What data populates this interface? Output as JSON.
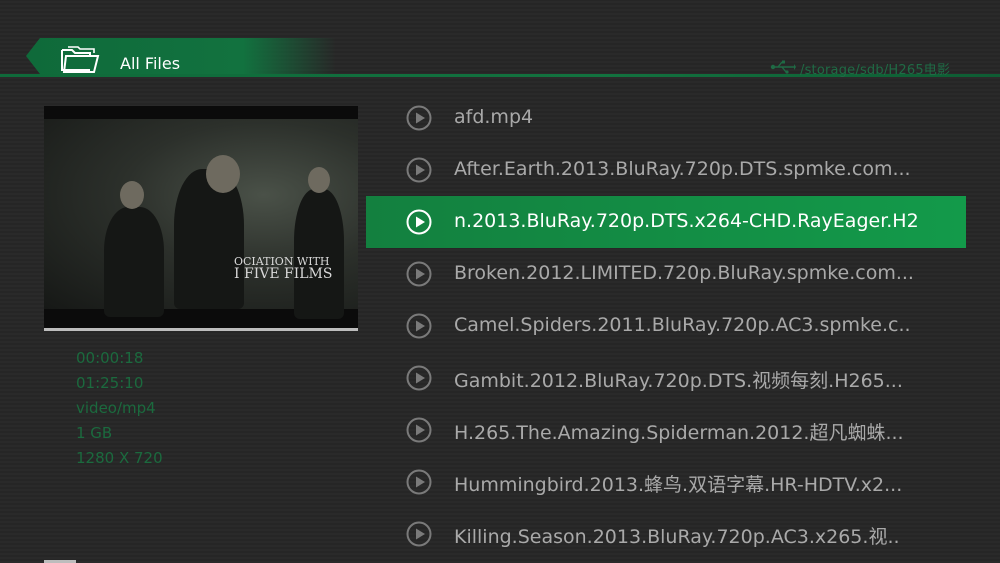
{
  "header": {
    "title": "All Files",
    "path": "/storage/sdb/H265电影",
    "folder_icon": "folder-icon",
    "usb_icon": "usb-icon"
  },
  "preview": {
    "overlay_line1": "OCIATION WITH",
    "overlay_line2": "I FIVE FILMS"
  },
  "meta": {
    "current_time": "00:00:18",
    "duration": "01:25:10",
    "mime": "video/mp4",
    "size": "1 GB",
    "resolution": "1280 X 720"
  },
  "files": [
    {
      "name": "afd.mp4",
      "selected": false
    },
    {
      "name": "After.Earth.2013.BluRay.720p.DTS.spmke.com...",
      "selected": false
    },
    {
      "name": "n.2013.BluRay.720p.DTS.x264-CHD.RayEager.H2",
      "selected": true
    },
    {
      "name": "Broken.2012.LIMITED.720p.BluRay.spmke.com...",
      "selected": false
    },
    {
      "name": "Camel.Spiders.2011.BluRay.720p.AC3.spmke.c..",
      "selected": false
    },
    {
      "name": "Gambit.2012.BluRay.720p.DTS.视频每刻.H265...",
      "selected": false
    },
    {
      "name": "H.265.The.Amazing.Spiderman.2012.超凡蜘蛛...",
      "selected": false
    },
    {
      "name": "Hummingbird.2013.蜂鸟.双语字幕.HR-HDTV.x2...",
      "selected": false
    },
    {
      "name": "Killing.Season.2013.BluRay.720p.AC3.x265.视..",
      "selected": false
    }
  ],
  "colors": {
    "accent": "#13803f",
    "meta_text": "#1b6a3e",
    "file_text": "#a9a9a9"
  }
}
